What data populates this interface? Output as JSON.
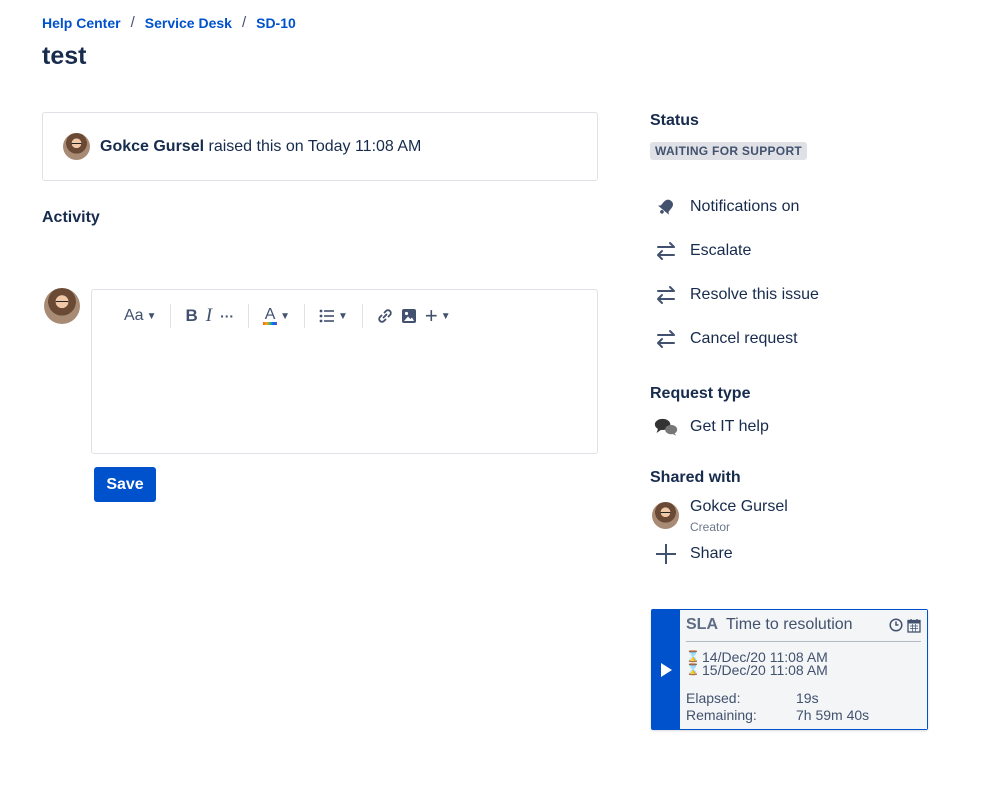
{
  "breadcrumb": {
    "items": [
      "Help Center",
      "Service Desk",
      "SD-10"
    ],
    "separator": "/"
  },
  "title": "test",
  "raised": {
    "author": "Gokce Gursel",
    "text": "raised this on Today 11:08 AM"
  },
  "activity": {
    "heading": "Activity"
  },
  "editor": {
    "text_style": "Aa",
    "bold": "B",
    "italic": "I",
    "more": "···",
    "color": "A",
    "plus": "+"
  },
  "save_label": "Save",
  "status": {
    "heading": "Status",
    "value": "WAITING FOR SUPPORT"
  },
  "actions": [
    "Notifications on",
    "Escalate",
    "Resolve this issue",
    "Cancel request"
  ],
  "request_type": {
    "heading": "Request type",
    "value": "Get IT help"
  },
  "shared_with": {
    "heading": "Shared with",
    "name": "Gokce Gursel",
    "role": "Creator",
    "share_label": "Share"
  },
  "sla": {
    "label": "SLA",
    "name": "Time to resolution",
    "start": "14/Dec/20 11:08 AM",
    "end": "15/Dec/20 11:08 AM",
    "elapsed_label": "Elapsed:",
    "elapsed": "19s",
    "remaining_label": "Remaining:",
    "remaining": "7h 59m 40s"
  },
  "colors": {
    "primary": "#0052cc",
    "text": "#172b4d",
    "lozenge_bg": "#dfe1e6"
  }
}
